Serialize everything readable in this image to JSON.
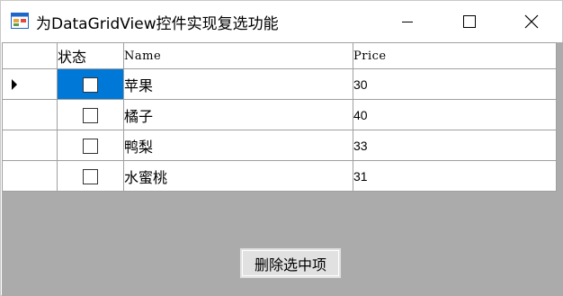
{
  "window": {
    "title": "为DataGridView控件实现复选功能",
    "icons": {
      "app": "app-form-icon",
      "minimize": "minimize-icon",
      "maximize": "maximize-icon",
      "close": "close-icon"
    }
  },
  "grid": {
    "columns": [
      "状态",
      "Name",
      "Price"
    ],
    "rows": [
      {
        "checked": false,
        "name": "苹果",
        "price": "30"
      },
      {
        "checked": false,
        "name": "橘子",
        "price": "40"
      },
      {
        "checked": false,
        "name": "鸭梨",
        "price": "33"
      },
      {
        "checked": false,
        "name": "水蜜桃",
        "price": "31"
      }
    ],
    "selection_color": "#0078d7"
  },
  "actions": {
    "delete_label": "删除选中项"
  },
  "colors": {
    "client_background": "#ababab",
    "button_face": "#e1e1e1"
  }
}
